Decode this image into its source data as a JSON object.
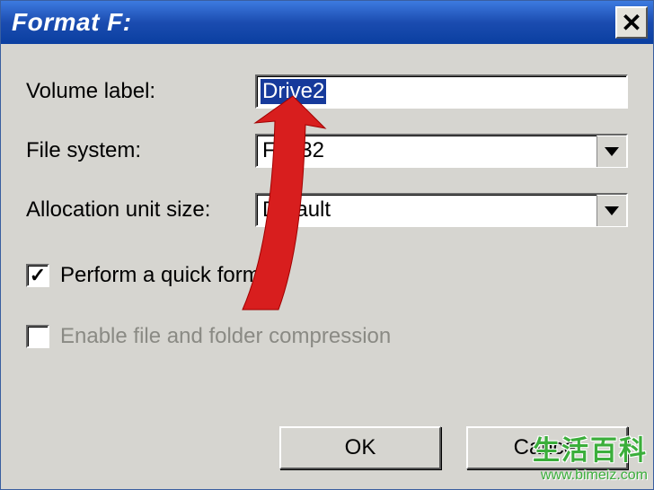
{
  "titlebar": {
    "title": "Format F:"
  },
  "labels": {
    "volume_label": "Volume label:",
    "file_system": "File system:",
    "allocation": "Allocation unit size:"
  },
  "fields": {
    "volume_value": "Drive2",
    "file_system_value": "FAT32",
    "allocation_value": "Default"
  },
  "checkboxes": {
    "quick_format": "Perform a quick format",
    "compression": "Enable file and folder compression"
  },
  "buttons": {
    "ok": "OK",
    "cancel": "Cancel"
  },
  "watermark": {
    "text": "生活百科",
    "url": "www.bimeiz.com"
  }
}
